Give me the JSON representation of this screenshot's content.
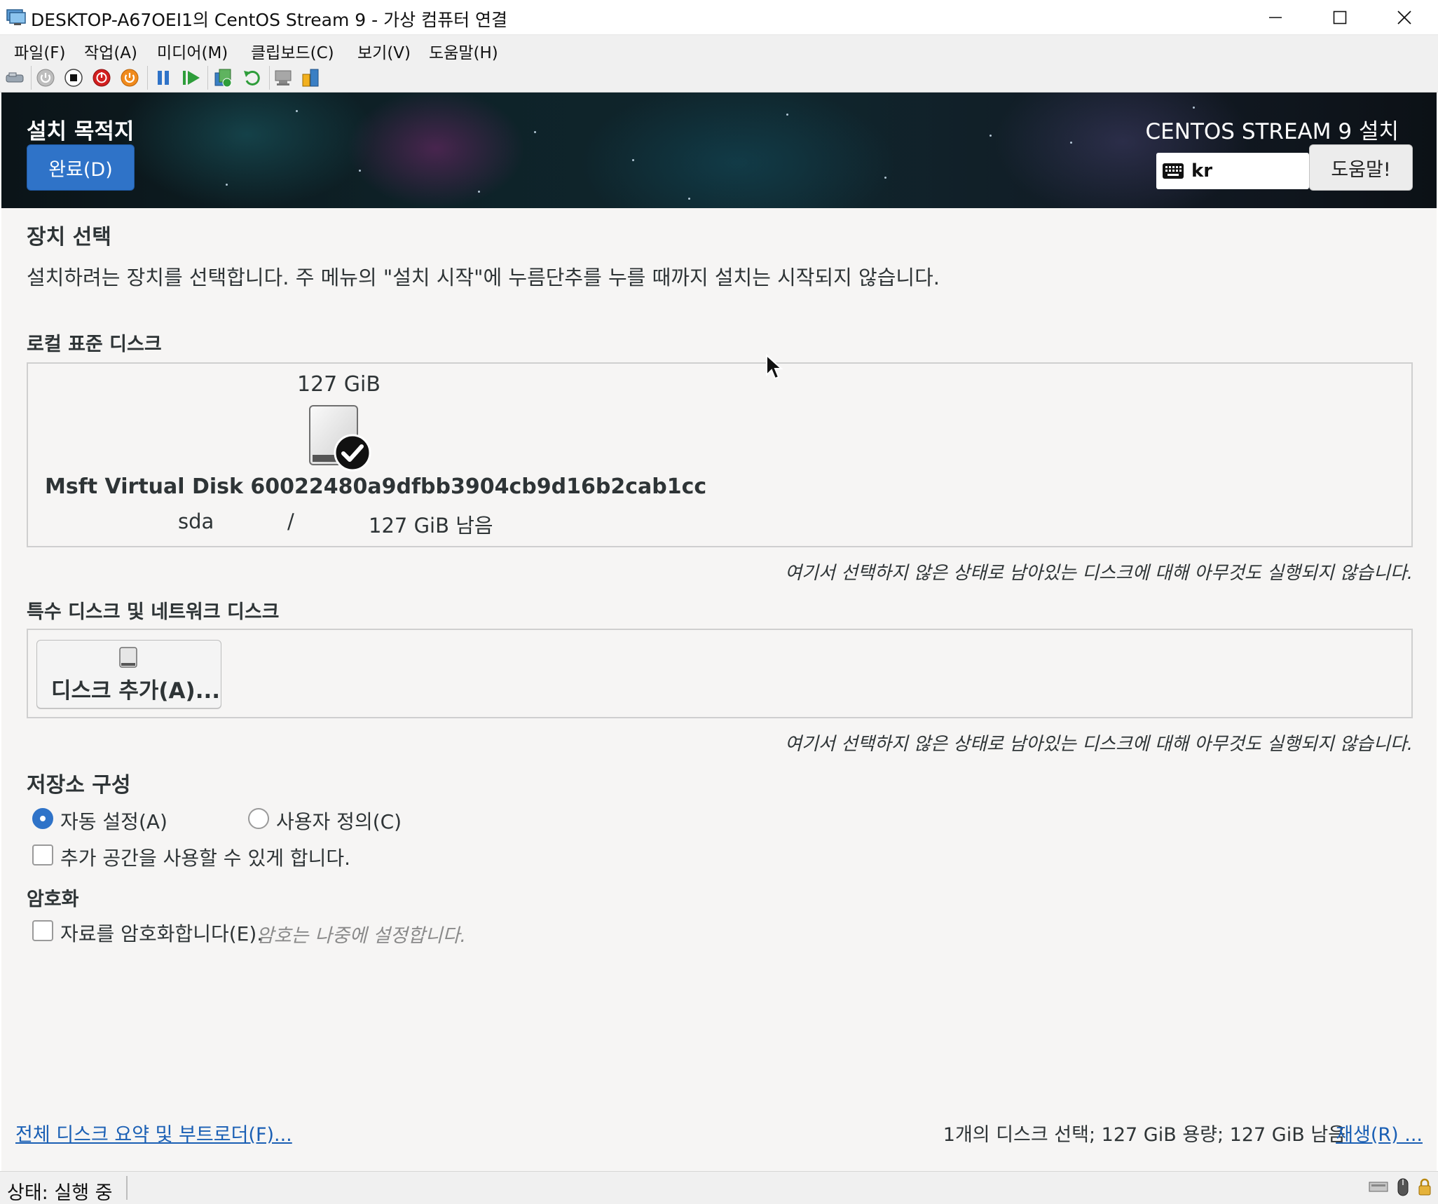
{
  "window": {
    "title": "DESKTOP-A67OEI1의 CentOS Stream 9 - 가상 컴퓨터 연결"
  },
  "menubar": {
    "items": [
      "파일(F)",
      "작업(A)",
      "미디어(M)",
      "클립보드(C)",
      "보기(V)",
      "도움말(H)"
    ]
  },
  "toolbar": {
    "icons": [
      "ctrl-alt-del-icon",
      "start-icon",
      "turn-off-icon",
      "shutdown-icon",
      "power-icon",
      "pause-icon",
      "resume-icon",
      "checkpoint-icon",
      "revert-icon",
      "enhanced-session-icon",
      "share-icon"
    ]
  },
  "header": {
    "page_title": "설치 목적지",
    "done_label": "완료(D)",
    "install_title": "CENTOS STREAM 9 설치",
    "keyboard_layout": "kr",
    "help_label": "도움말!"
  },
  "device_selection": {
    "heading": "장치 선택",
    "description": "설치하려는 장치를 선택합니다. 주 메뉴의 \"설치 시작\"에 누름단추를 누를 때까지 설치는 시작되지 않습니다."
  },
  "local_disks": {
    "heading": "로컬 표준 디스크",
    "disk": {
      "size": "127 GiB",
      "name": "Msft Virtual Disk 60022480a9dfbb3904cb9d16b2cab1cc",
      "device": "sda",
      "separator": "/",
      "free": "127 GiB 남음",
      "selected": true
    },
    "note": "여기서 선택하지 않은 상태로 남아있는 디스크에 대해 아무것도 실행되지 않습니다."
  },
  "special_disks": {
    "heading": "특수 디스크 및 네트워크 디스크",
    "add_disk_label": "디스크 추가(A)...",
    "note": "여기서 선택하지 않은 상태로 남아있는 디스크에 대해 아무것도 실행되지 않습니다."
  },
  "storage_config": {
    "heading": "저장소 구성",
    "auto_label": "자동 설정(A)",
    "custom_label": "사용자 정의(C)",
    "selected": "auto",
    "extra_space_label": "추가 공간을 사용할 수 있게 합니다."
  },
  "encryption": {
    "heading": "암호화",
    "encrypt_label": "자료를 암호화합니다(E).",
    "hint": "암호는 나중에 설정합니다."
  },
  "footer": {
    "summary_link": "전체 디스크 요약 및 부트로더(F)...",
    "summary_text": "1개의 디스크 선택; 127 GiB 용량; 127 GiB 남음",
    "refresh_link": "재생(R) ..."
  },
  "statusbar": {
    "text": "상태: 실행 중"
  },
  "colors": {
    "accent": "#2f73c8",
    "link": "#1a5fb4"
  }
}
